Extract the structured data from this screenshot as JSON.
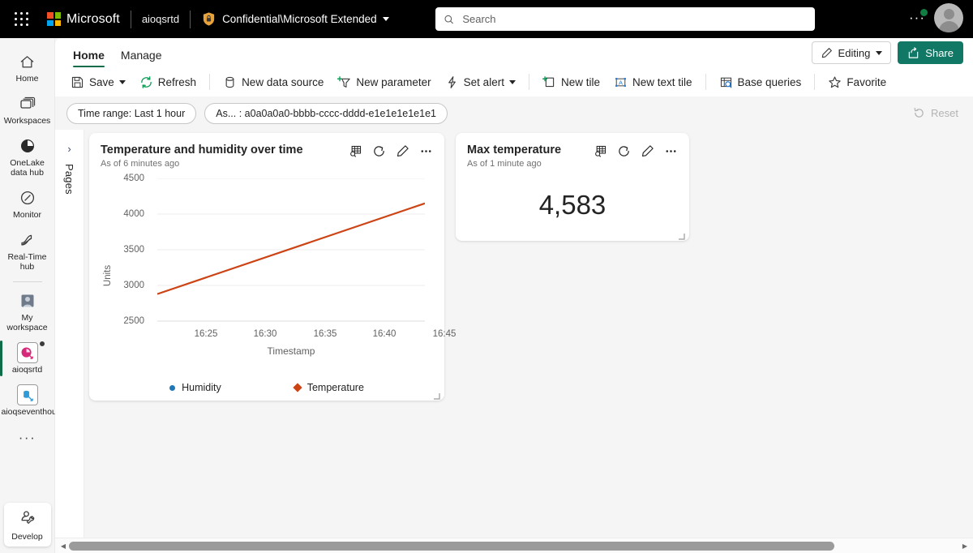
{
  "topbar": {
    "waffle": "app-launcher",
    "brand": "Microsoft",
    "tenant": "aioqsrtd",
    "sensitivity_label": "Confidential\\Microsoft Extended",
    "search_placeholder": "Search",
    "search_value": "",
    "overflow": "···"
  },
  "rail": {
    "items": [
      {
        "label": "Home",
        "icon": "home-icon",
        "selected": false
      },
      {
        "label": "Workspaces",
        "icon": "workspaces-icon",
        "selected": false
      },
      {
        "label": "OneLake data hub",
        "icon": "onelake-icon",
        "selected": false
      },
      {
        "label": "Monitor",
        "icon": "monitor-icon",
        "selected": false
      },
      {
        "label": "Real-Time hub",
        "icon": "realtime-hub-icon",
        "selected": false
      },
      {
        "label": "My workspace",
        "icon": "my-workspace-icon",
        "selected": false
      },
      {
        "label": "aioqsrtd",
        "icon": "dashboard-item-icon",
        "selected": true
      },
      {
        "label": "aioqseventhouse",
        "icon": "eventhouse-icon",
        "selected": false
      }
    ],
    "overflow": "···",
    "develop": "Develop"
  },
  "ribbon": {
    "tabs": [
      {
        "label": "Home",
        "active": true
      },
      {
        "label": "Manage",
        "active": false
      }
    ],
    "editing_label": "Editing",
    "share_label": "Share"
  },
  "toolbar": {
    "save": "Save",
    "refresh": "Refresh",
    "new_data_source": "New data source",
    "new_parameter": "New parameter",
    "set_alert": "Set alert",
    "new_tile": "New tile",
    "new_text_tile": "New text tile",
    "base_queries": "Base queries",
    "favorite": "Favorite"
  },
  "filters": {
    "pills": [
      "Time range: Last 1 hour",
      "As... : a0a0a0a0-bbbb-cccc-dddd-e1e1e1e1e1e1"
    ],
    "reset": "Reset"
  },
  "pages_panel": {
    "label": "Pages",
    "expand": "›"
  },
  "tiles": [
    {
      "title": "Temperature and humidity over time",
      "subtitle": "As of 6 minutes ago",
      "actions": [
        "explore-data-icon",
        "refresh-icon",
        "edit-icon",
        "more-options-icon"
      ]
    },
    {
      "title": "Max temperature",
      "subtitle": "As of 1 minute ago",
      "value": "4,583",
      "actions": [
        "explore-data-icon",
        "refresh-icon",
        "edit-icon",
        "more-options-icon"
      ]
    }
  ],
  "chart_data": {
    "type": "line",
    "title": "Temperature and humidity over time",
    "xlabel": "Timestamp",
    "ylabel": "Units",
    "ylim": [
      2500,
      4500
    ],
    "yticks": [
      2500,
      3000,
      3500,
      4000,
      4500
    ],
    "xticks": [
      "16:25",
      "16:30",
      "16:35",
      "16:40",
      "16:45"
    ],
    "grid": true,
    "legend_position": "bottom",
    "series": [
      {
        "name": "Humidity",
        "color": "#1f77b4",
        "marker": "circle",
        "x": [],
        "values": []
      },
      {
        "name": "Temperature",
        "color": "#cc4314",
        "marker": "diamond",
        "x": [
          "16:23",
          "16:46"
        ],
        "values": [
          2880,
          4150
        ]
      }
    ]
  },
  "colors": {
    "accent_green": "#117865",
    "selection_green": "#0f6c49",
    "temperature": "#cc4314",
    "humidity": "#1f77b4"
  },
  "scrollbar": {
    "left_arrow": "◀",
    "right_arrow": "▶",
    "thumb_percent": 86
  }
}
